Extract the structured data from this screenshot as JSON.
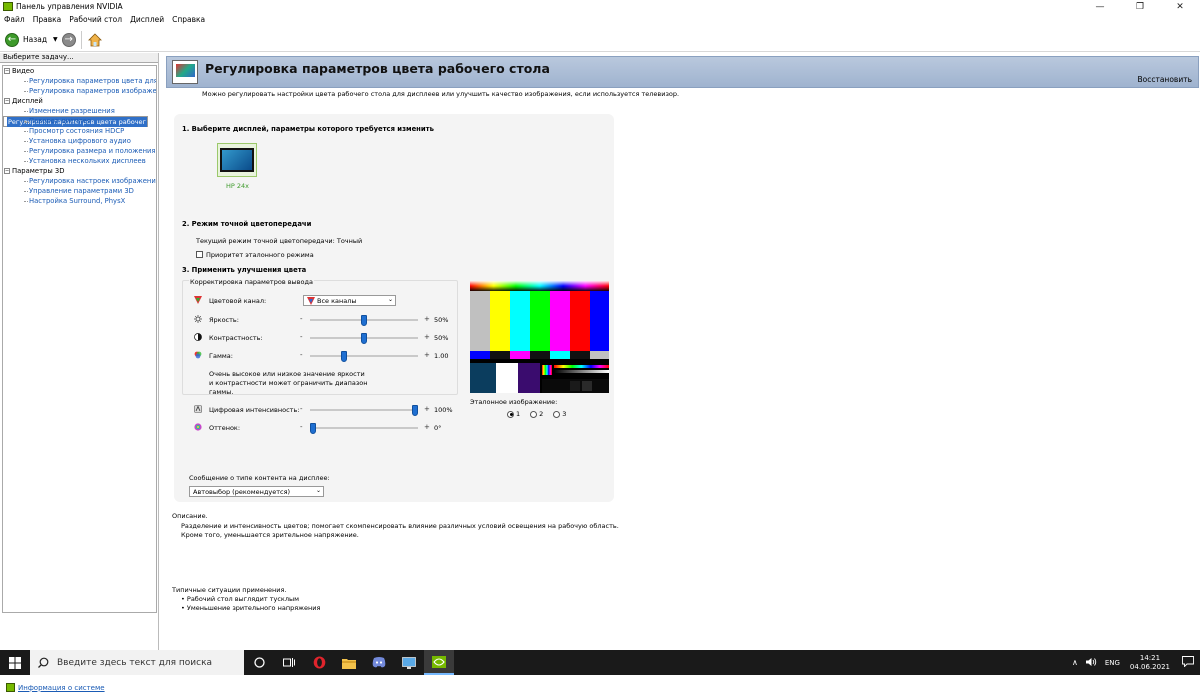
{
  "window": {
    "title": "Панель управления NVIDIA",
    "controls": {
      "minimize": "—",
      "maximize": "❐",
      "close": "✕"
    }
  },
  "menu": [
    "Файл",
    "Правка",
    "Рабочий стол",
    "Дисплей",
    "Справка"
  ],
  "toolbar": {
    "back_label": "Назад"
  },
  "sidebar": {
    "header": "Выберите задачу...",
    "categories": [
      {
        "label": "Видео",
        "items": [
          "Регулировка параметров цвета для вид",
          "Регулировка параметров изображения д"
        ]
      },
      {
        "label": "Дисплей",
        "items": [
          "Изменение разрешения",
          "Регулировка параметров цвета рабочег",
          "Поворот дисплея",
          "Просмотр состояния HDCP",
          "Установка цифрового аудио",
          "Регулировка размера и положения рабо",
          "Установка нескольких дисплеев"
        ]
      },
      {
        "label": "Параметры 3D",
        "items": [
          "Регулировка настроек изображения с пр",
          "Управление параметрами 3D",
          "Настройка Surround, PhysX"
        ]
      }
    ],
    "selected": "Регулировка параметров цвета рабочег",
    "system_info": "Информация о системе"
  },
  "page": {
    "title": "Регулировка параметров цвета рабочего стола",
    "restore": "Восстановить",
    "description": "Можно регулировать настройки цвета рабочего стола для дисплеев или улучшить качество изображения, если используется телевизор.",
    "step1": "1. Выберите дисплей, параметры которого требуется изменить",
    "display_name": "HP 24x",
    "step2": "2. Режим точной цветопередачи",
    "current_mode": "Текущий режим точной цветопередачи: Точный",
    "reference_priority": "Приоритет эталонного режима",
    "step3": "3. Применить улучшения цвета",
    "output_group": "Корректировка параметров вывода",
    "channel_label": "Цветовой канал:",
    "channel_value": "Все каналы",
    "brightness_label": "Яркость:",
    "brightness_value": "50%",
    "brightness": 0.5,
    "contrast_label": "Контрастность:",
    "contrast_value": "50%",
    "contrast": 0.5,
    "gamma_label": "Гамма:",
    "gamma_value": "1.00",
    "gamma": 0.3,
    "gamma_note": "Очень высокое или низкое значение яркости и контрастности может ограничить диапазон гаммы.",
    "vibrance_label": "Цифровая интенсивность:",
    "vibrance_value": "100%",
    "vibrance": 1.0,
    "hue_label": "Оттенок:",
    "hue_value": "0°",
    "hue": 0.0,
    "minus": "-",
    "plus": "+",
    "reference_image_label": "Эталонное изображение:",
    "reference_options": [
      "1",
      "2",
      "3"
    ],
    "reference_selected": "1",
    "content_type_label": "Сообщение о типе контента на дисплее:",
    "content_type_value": "Автовыбор (рекомендуется)",
    "desc_title": "Описание.",
    "desc_text": "Разделение и интенсивность цветов; помогает скомпенсировать влияние различных условий освещения на рабочую область.",
    "desc_text2": "Кроме того, уменьшается зрительное напряжение.",
    "usage_title": "Типичные ситуации применения.",
    "usage_items": [
      "Рабочий стол выглядит тусклым",
      "Уменьшение зрительного напряжения"
    ]
  },
  "taskbar": {
    "search_placeholder": "Введите здесь текст для поиска",
    "language": "ENG",
    "time": "14:21",
    "date": "04.06.2021"
  },
  "colors": {
    "nvidia_green": "#76b900",
    "slider_thumb": "#1f6fd1",
    "link": "#1a5bb5"
  }
}
